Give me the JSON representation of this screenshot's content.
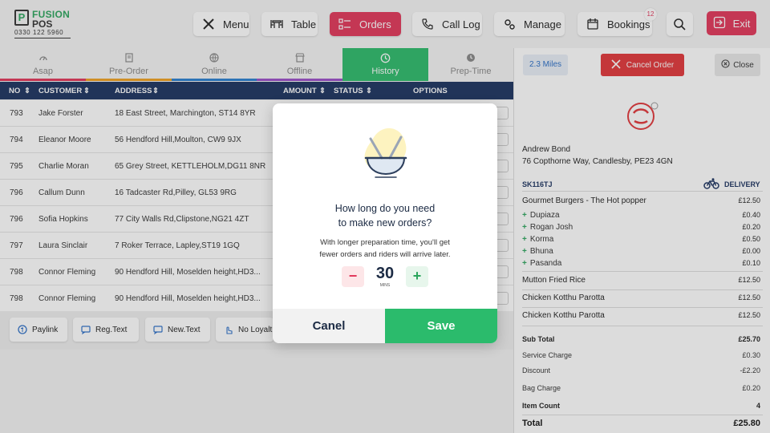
{
  "logo": {
    "line1": "FUSION",
    "line2": "POS",
    "mark": "P",
    "phone": "0330 122 5960"
  },
  "nav": {
    "menu": "Menu",
    "table": "Table",
    "orders": "Orders",
    "call_log": "Call Log",
    "manage": "Manage",
    "bookings": "Bookings",
    "bookings_badge": "12",
    "exit": "Exit"
  },
  "tabs": [
    "Asap",
    "Pre-Order",
    "Online",
    "Offline",
    "History",
    "Prep-Time"
  ],
  "table": {
    "headers": [
      "NO",
      "CUSTOMER",
      "ADDRESS",
      "AMOUNT",
      "STATUS",
      "OPTIONS"
    ],
    "rows": [
      {
        "no": "793",
        "customer": "Jake Forster",
        "address": "18 East Street, Marchington, ST14 8YR"
      },
      {
        "no": "794",
        "customer": "Eleanor Moore",
        "address": "56 Hendford Hill,Moulton, CW9 9JX"
      },
      {
        "no": "795",
        "customer": "Charlie Moran",
        "address": "65 Grey Street, KETTLEHOLM,DG11 8NR"
      },
      {
        "no": "796",
        "customer": "Callum Dunn",
        "address": "16 Tadcaster Rd,Pilley, GL53 9RG"
      },
      {
        "no": "796",
        "customer": "Sofia Hopkins",
        "address": "77 City Walls Rd,Clipstone,NG21 4ZT"
      },
      {
        "no": "797",
        "customer": "Laura Sinclair",
        "address": "7 Roker Terrace, Lapley,ST19 1GQ"
      },
      {
        "no": "798",
        "customer": "Connor Fleming",
        "address": "90 Hendford Hill, Moselden height,HD3..."
      },
      {
        "no": "798",
        "customer": "Connor Fleming",
        "address": "90 Hendford Hill, Moselden height,HD3..."
      }
    ]
  },
  "actions": {
    "paylink": "Paylink",
    "reg_text": "Reg.Text",
    "new_text": "New.Text",
    "no_loyalty": "No Loyalt"
  },
  "order": {
    "miles": "2.3 Miles",
    "cancel": "Cancel Order",
    "close": "Close",
    "customer_name": "Andrew Bond",
    "customer_address": "76 Copthorne Way, Candlesby, PE23 4GN",
    "ref": "SK116TJ",
    "type": "DELIVERY",
    "items": [
      {
        "name": "Gourmet Burgers - The Hot popper",
        "price": "£12.50"
      },
      {
        "name": "Dupiaza",
        "price": "£0.40",
        "sub": true
      },
      {
        "name": "Rogan Josh",
        "price": "£0.20",
        "sub": true
      },
      {
        "name": "Korma",
        "price": "£0.50",
        "sub": true
      },
      {
        "name": "Bhuna",
        "price": "£0.00",
        "sub": true
      },
      {
        "name": "Pasanda",
        "price": "£0.10",
        "sub": true
      },
      {
        "name": "Mutton Fried Rice",
        "price": "£12.50"
      },
      {
        "name": "Chicken Kotthu Parotta",
        "price": "£12.50"
      },
      {
        "name": "Chicken Kotthu Parotta",
        "price": "£12.50"
      }
    ],
    "totals": [
      {
        "name": "Sub Total",
        "value": "£25.70",
        "bold": true
      },
      {
        "name": "Service Charge",
        "value": "£0.30"
      },
      {
        "name": "Discount",
        "value": "-£2.20"
      },
      {
        "name": "Bag Charge",
        "value": "£0.20"
      },
      {
        "name": "Item Count",
        "value": "4",
        "bold": true
      }
    ],
    "total_label": "Total",
    "total_value": "£25.80"
  },
  "modal": {
    "question_line1": "How long do you need",
    "question_line2": "to make new orders?",
    "desc_line1": "With longer preparation time, you'll get",
    "desc_line2": "fewer orders and riders will arrive later.",
    "minutes": "30",
    "minutes_label": "MINS",
    "minus": "−",
    "plus": "+",
    "cancel": "Canel",
    "save": "Save"
  },
  "colors": {
    "accent_green": "#2bbb6c",
    "accent_red": "#e2365a",
    "navy": "#1c3360"
  }
}
